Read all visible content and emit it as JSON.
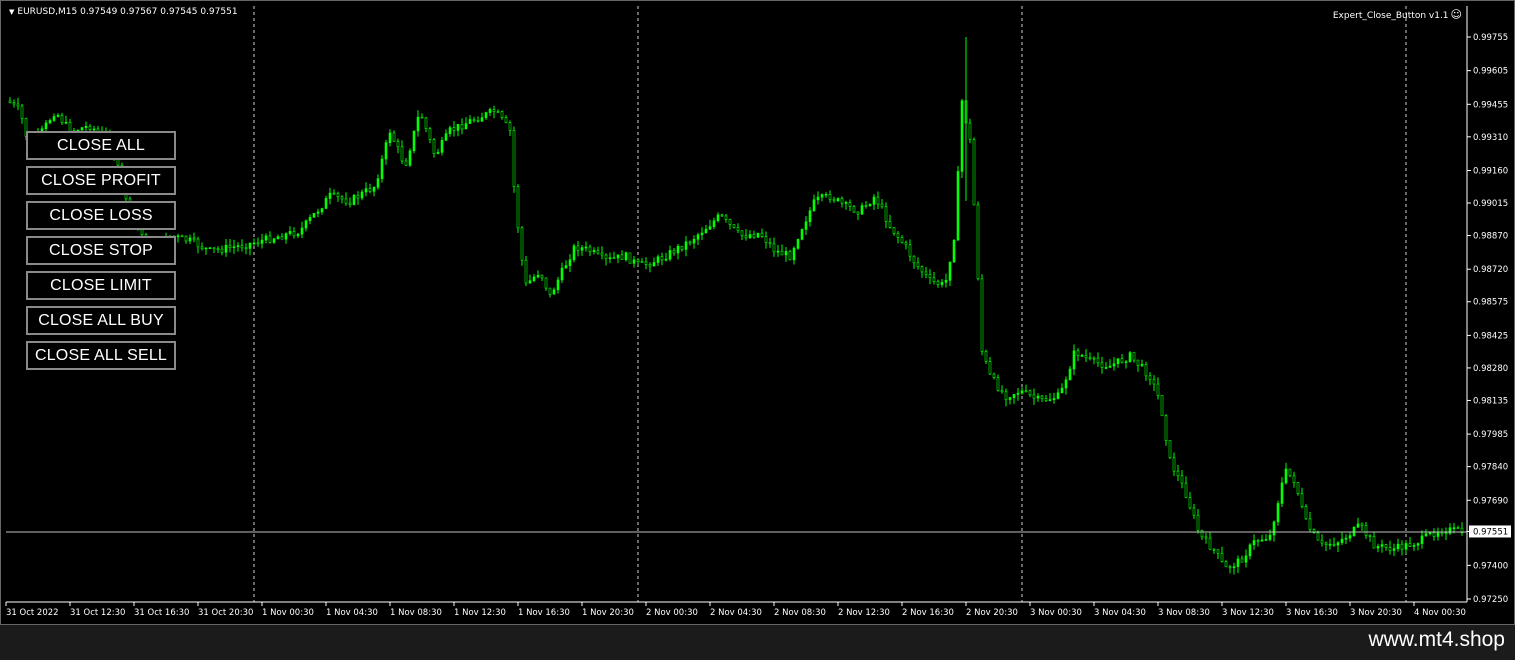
{
  "chart": {
    "symbol_text": "EURUSD,M15  0.97549 0.97567 0.97545 0.97551",
    "ea_name": "Expert_Close_Button v1.1",
    "current_price": "0.97551",
    "candle_color": "#00ff00",
    "price_levels": [
      "0.99755",
      "0.99605",
      "0.99455",
      "0.99310",
      "0.99160",
      "0.99015",
      "0.98870",
      "0.98720",
      "0.98575",
      "0.98425",
      "0.98280",
      "0.98135",
      "0.97985",
      "0.97840",
      "0.97690",
      "0.97551",
      "0.97400",
      "0.97250"
    ],
    "time_labels": [
      "31 Oct 2022",
      "31 Oct 12:30",
      "31 Oct 16:30",
      "31 Oct 20:30",
      "1 Nov 00:30",
      "1 Nov 04:30",
      "1 Nov 08:30",
      "1 Nov 12:30",
      "1 Nov 16:30",
      "1 Nov 20:30",
      "2 Nov 00:30",
      "2 Nov 04:30",
      "2 Nov 08:30",
      "2 Nov 12:30",
      "2 Nov 16:30",
      "2 Nov 20:30",
      "3 Nov 00:30",
      "3 Nov 04:30",
      "3 Nov 08:30",
      "3 Nov 12:30",
      "3 Nov 16:30",
      "3 Nov 20:30",
      "4 Nov 00:30"
    ]
  },
  "buttons": {
    "close_all": "CLOSE ALL",
    "close_profit": "CLOSE PROFIT",
    "close_loss": "CLOSE LOSS",
    "close_stop": "CLOSE STOP",
    "close_limit": "CLOSE LIMIT",
    "close_all_buy": "CLOSE ALL BUY",
    "close_all_sell": "CLOSE ALL SELL"
  },
  "footer": {
    "watermark": "www.mt4.shop"
  }
}
